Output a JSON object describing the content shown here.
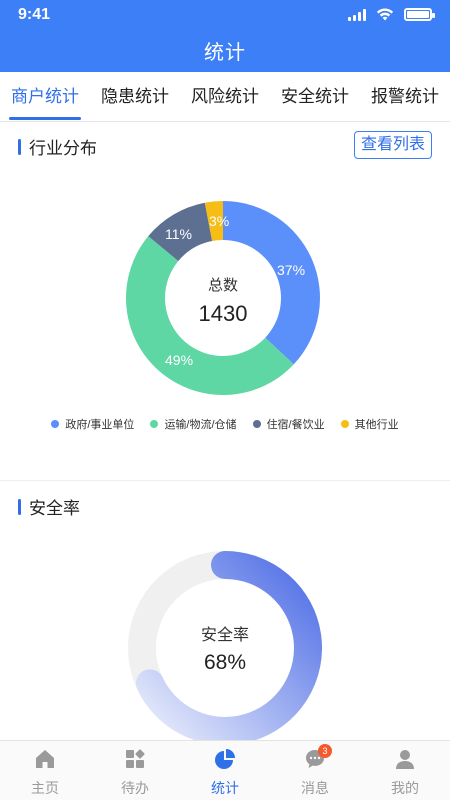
{
  "status_bar": {
    "time": "9:41"
  },
  "nav": {
    "title": "统计"
  },
  "tabs": [
    {
      "label": "商户统计",
      "active": true
    },
    {
      "label": "隐患统计",
      "active": false
    },
    {
      "label": "风险统计",
      "active": false
    },
    {
      "label": "安全统计",
      "active": false
    },
    {
      "label": "报警统计",
      "active": false
    }
  ],
  "industry": {
    "title": "行业分布",
    "list_button": "查看列表",
    "center_label": "总数",
    "center_value": "1430"
  },
  "chart_data": {
    "type": "pie",
    "categories": [
      "政府/事业单位",
      "运输/物流/仓储",
      "住宿/餐饮业",
      "其他行业"
    ],
    "values": [
      37,
      49,
      11,
      3
    ],
    "labels": [
      "37%",
      "49%",
      "11%",
      "3%"
    ],
    "colors": [
      "#5b8ff9",
      "#5ed7a5",
      "#5d7092",
      "#f6bd16"
    ],
    "total": 1430
  },
  "safety": {
    "title": "安全率",
    "center_label": "安全率",
    "center_value": "68%",
    "rate": 0.68,
    "colors": {
      "start": "#4f6ee6",
      "end": "#e8ecfb",
      "track": "#f0f0f0"
    }
  },
  "bottom_nav": [
    {
      "label": "主页",
      "icon": "home-icon",
      "active": false
    },
    {
      "label": "待办",
      "icon": "todo-grid-icon",
      "active": false
    },
    {
      "label": "统计",
      "icon": "pie-chart-icon",
      "active": true
    },
    {
      "label": "消息",
      "icon": "message-icon",
      "active": false,
      "badge": "3"
    },
    {
      "label": "我的",
      "icon": "user-icon",
      "active": false
    }
  ]
}
